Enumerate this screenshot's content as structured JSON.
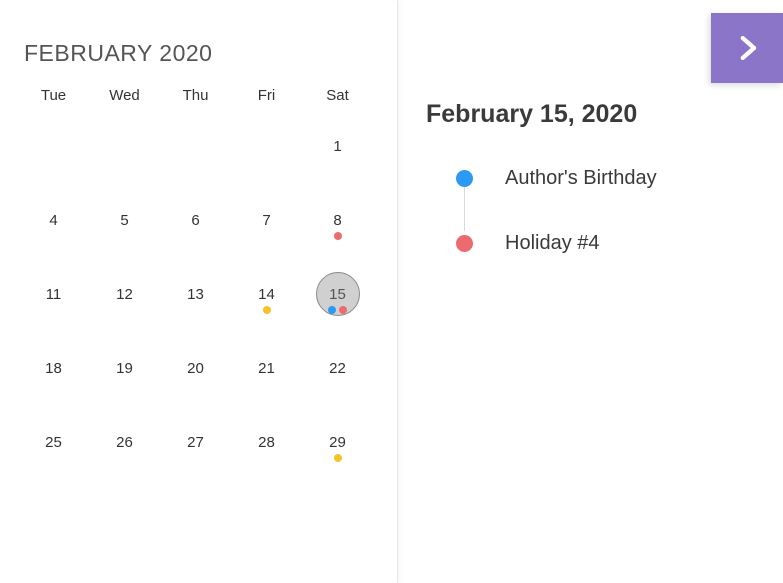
{
  "colors": {
    "accent": "#8a75c9",
    "blue": "#2c9af2",
    "pink": "#ec6b6f",
    "yellow": "#f3c32a"
  },
  "calendar": {
    "title": "FEBRUARY 2020",
    "dow": [
      "Tue",
      "Wed",
      "Thu",
      "Fri",
      "Sat"
    ],
    "weeks": [
      [
        {
          "n": ""
        },
        {
          "n": ""
        },
        {
          "n": ""
        },
        {
          "n": ""
        },
        {
          "n": "1"
        }
      ],
      [
        {
          "n": "4"
        },
        {
          "n": "5"
        },
        {
          "n": "6"
        },
        {
          "n": "7"
        },
        {
          "n": "8",
          "dots": [
            "pink"
          ]
        }
      ],
      [
        {
          "n": "11"
        },
        {
          "n": "12"
        },
        {
          "n": "13"
        },
        {
          "n": "14",
          "dots": [
            "yellow"
          ]
        },
        {
          "n": "15",
          "dots": [
            "blue",
            "pink"
          ],
          "selected": true
        }
      ],
      [
        {
          "n": "18"
        },
        {
          "n": "19"
        },
        {
          "n": "20"
        },
        {
          "n": "21"
        },
        {
          "n": "22"
        }
      ],
      [
        {
          "n": "25"
        },
        {
          "n": "26"
        },
        {
          "n": "27"
        },
        {
          "n": "28"
        },
        {
          "n": "29",
          "dots": [
            "yellow"
          ]
        }
      ]
    ]
  },
  "detail": {
    "date": "February 15, 2020",
    "events": [
      {
        "color": "blue",
        "label": "Author's Birthday"
      },
      {
        "color": "pink",
        "label": "Holiday #4"
      }
    ]
  }
}
